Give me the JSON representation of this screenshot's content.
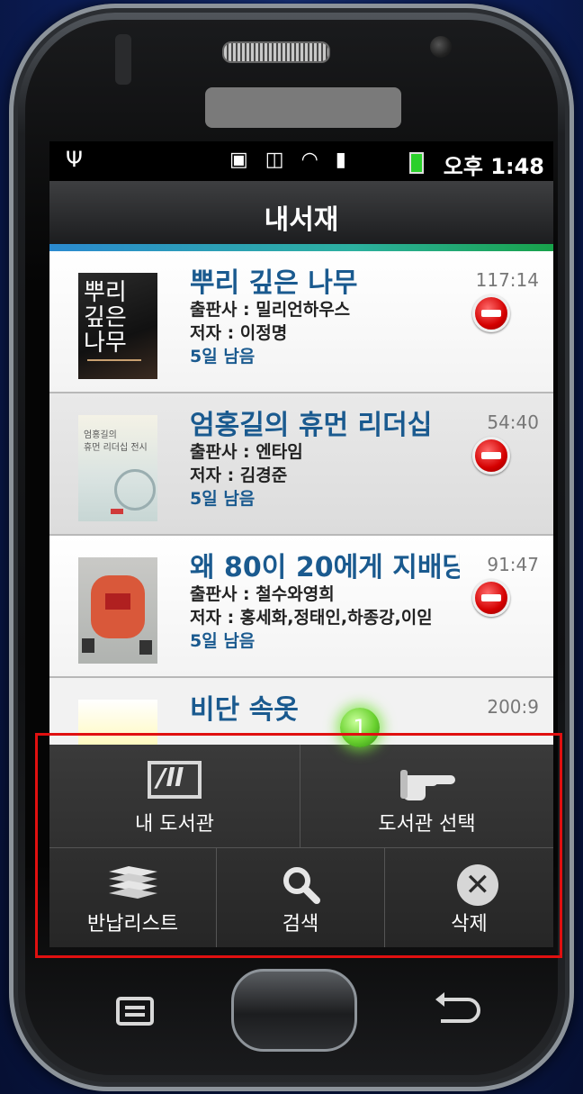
{
  "status_bar": {
    "time": "오후 1:48"
  },
  "header": {
    "title": "내서재"
  },
  "books": [
    {
      "title": "뿌리 깊은 나무",
      "publisher": "출판사 : 밀리언하우스",
      "author": "저자 : 이정명",
      "due": "5일 남음",
      "duration": "117:14"
    },
    {
      "title": "엄홍길의 휴먼 리더십",
      "publisher": "출판사 : 엔타임",
      "author": "저자 : 김경준",
      "due": "5일 남음",
      "duration": "54:40"
    },
    {
      "title": "왜 80이 20에게 지배당",
      "publisher": "출판사 : 철수와영희",
      "author": "저자 : 홍세화,정태인,하종강,이읻",
      "due": "5일 남음",
      "duration": "91:47"
    },
    {
      "title": "비단 속옷",
      "duration": "200:9"
    }
  ],
  "menu": {
    "my_library": "내 도서관",
    "select_library": "도서관 선택",
    "return_list": "반납리스트",
    "search": "검색",
    "delete": "삭제"
  },
  "badge": {
    "count": "1"
  },
  "icons": {
    "usb": "usb-icon",
    "battery": "battery-icon",
    "library": "library-icon",
    "hand": "hand-pointer-icon",
    "stack": "book-stack-icon",
    "search": "search-icon",
    "close": "close-circle-icon",
    "remove": "remove-circle-icon",
    "menu_key": "menu-key-icon",
    "back_key": "back-key-icon"
  },
  "colors": {
    "title_blue": "#1a5a8f",
    "accent_start": "#2b8ad0",
    "accent_end": "#18a24a",
    "highlight": "#e01010"
  }
}
